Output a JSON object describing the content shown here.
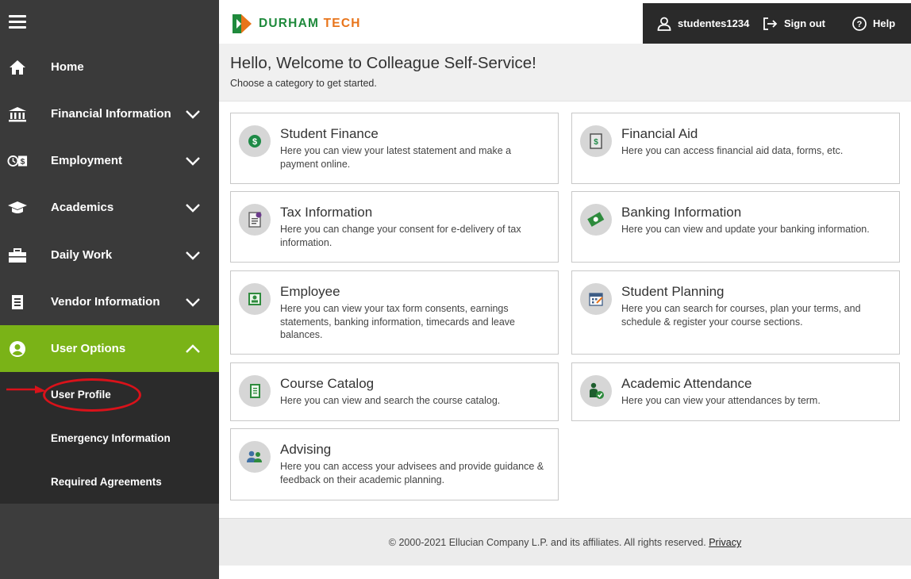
{
  "sidebar": {
    "menu_icon": "hamburger-menu-icon",
    "items": [
      {
        "label": "Home",
        "icon": "home-icon"
      },
      {
        "label": "Financial Information",
        "icon": "bank-icon"
      },
      {
        "label": "Employment",
        "icon": "employment-icon"
      },
      {
        "label": "Academics",
        "icon": "graduation-cap-icon"
      },
      {
        "label": "Daily Work",
        "icon": "briefcase-icon"
      },
      {
        "label": "Vendor Information",
        "icon": "document-icon"
      },
      {
        "label": "User Options",
        "icon": "user-circle-icon"
      }
    ],
    "submenu": [
      "User Profile",
      "Emergency Information",
      "Required Agreements"
    ],
    "active_color": "#7ab317"
  },
  "header": {
    "logo_text_1": "DURHAM",
    "logo_text_2": "TECH",
    "username": "studentes1234",
    "sign_out": "Sign out",
    "help": "Help"
  },
  "welcome": {
    "title": "Hello, Welcome to Colleague Self-Service!",
    "subtitle": "Choose a category to get started."
  },
  "cards": [
    {
      "title": "Student Finance",
      "desc": "Here you can view your latest statement and make a payment online.",
      "icon": "dollar-coin-icon"
    },
    {
      "title": "Financial Aid",
      "desc": "Here you can access financial aid data, forms, etc.",
      "icon": "money-doc-icon"
    },
    {
      "title": "Tax Information",
      "desc": "Here you can change your consent for e-delivery of tax information.",
      "icon": "tax-form-icon"
    },
    {
      "title": "Banking Information",
      "desc": "Here you can view and update your banking information.",
      "icon": "cash-icon"
    },
    {
      "title": "Employee",
      "desc": "Here you can view your tax form consents, earnings statements, banking information, timecards and leave balances.",
      "icon": "id-badge-icon"
    },
    {
      "title": "Student Planning",
      "desc": "Here you can search for courses, plan your terms, and schedule & register your course sections.",
      "icon": "calendar-icon"
    },
    {
      "title": "Course Catalog",
      "desc": "Here you can view and search the course catalog.",
      "icon": "catalog-book-icon"
    },
    {
      "title": "Academic Attendance",
      "desc": "Here you can view your attendances by term.",
      "icon": "attendance-check-icon"
    },
    {
      "title": "Advising",
      "desc": "Here you can access your advisees and provide guidance & feedback on their academic planning.",
      "icon": "people-icon"
    }
  ],
  "footer": {
    "text": "© 2000-2021 Ellucian Company L.P. and its affiliates. All rights reserved.",
    "privacy": "Privacy"
  }
}
